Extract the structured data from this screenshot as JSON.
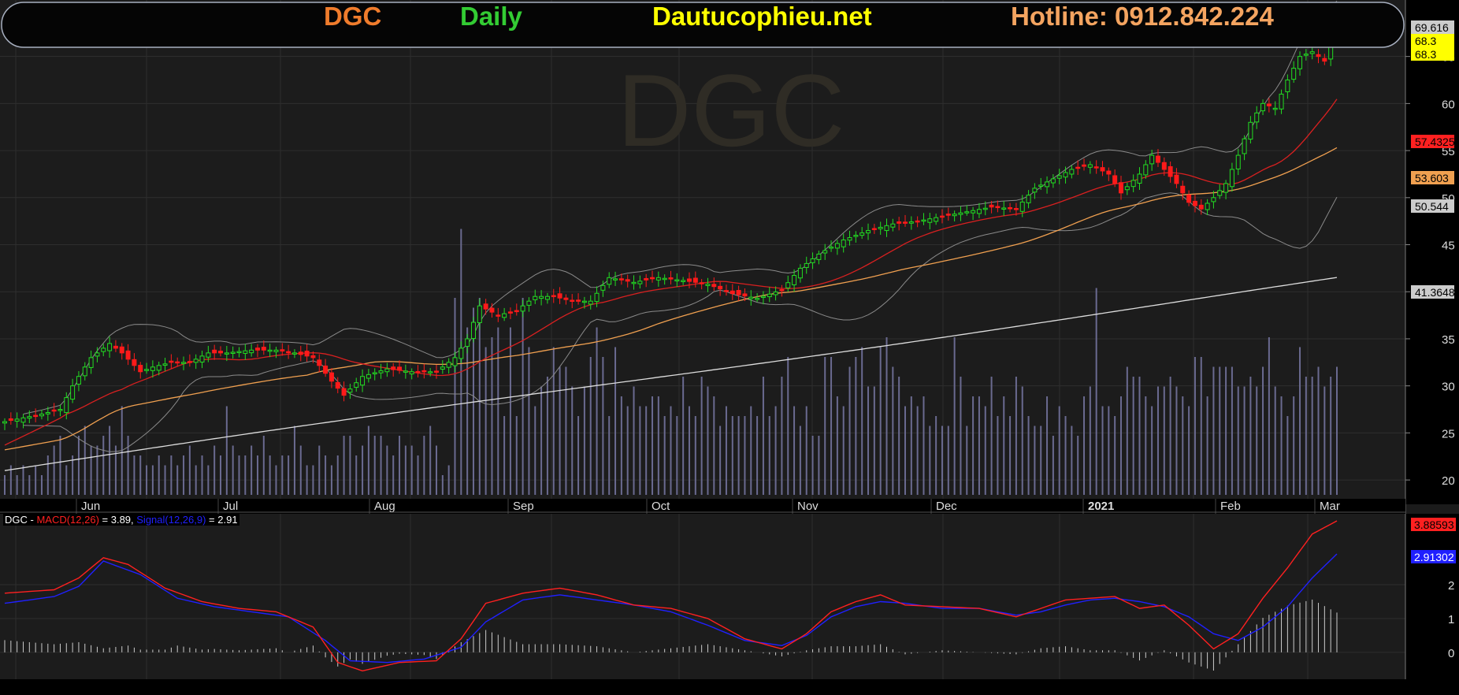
{
  "header": {
    "ticker": "DGC",
    "interval": "Daily",
    "site": "Dautucophieu.net",
    "hotline": "Hotline: 0912.842.224"
  },
  "colors": {
    "ticker": "#f07c2c",
    "interval": "#33cc33",
    "site": "#ffff00",
    "hotline": "#f4a460",
    "up_candle": "#22dd22",
    "down_candle": "#ff1a1a",
    "macd": "#ff2020",
    "signal": "#2020ff",
    "ma_short": "#d92020",
    "ma_mid": "#f0a050",
    "ma_long": "#dddddd",
    "bollinger": "#8a8a8a",
    "volume": "#6a6a90"
  },
  "watermark": "DGC",
  "chart_data": [
    {
      "type": "candlestick",
      "title": "DGC Daily",
      "x_labels": [
        "Jun",
        "Jul",
        "Aug",
        "Sep",
        "Oct",
        "Nov",
        "Dec",
        "2021",
        "Feb",
        "Mar"
      ],
      "y_ticks": [
        "20",
        "25",
        "30",
        "35",
        "40",
        "45",
        "50",
        "55",
        "60",
        "65"
      ],
      "ylim": [
        18,
        71
      ],
      "price_tags": [
        {
          "label": "69.616",
          "value": 69.616,
          "bg": "#cccccc",
          "fg": "#000000"
        },
        {
          "label": "68.3",
          "value": 68.3,
          "bg": "#ffff00",
          "fg": "#000000"
        },
        {
          "label": "68.3",
          "value": 68.3,
          "bg": "#ffff00",
          "fg": "#000000"
        },
        {
          "label": "57.4325",
          "value": 57.4325,
          "bg": "#ff2020",
          "fg": "#000000"
        },
        {
          "label": "53.603",
          "value": 53.603,
          "bg": "#f0a050",
          "fg": "#000000"
        },
        {
          "label": "50.544",
          "value": 50.544,
          "bg": "#cccccc",
          "fg": "#000000"
        },
        {
          "label": "41.3648",
          "value": 41.3648,
          "bg": "#cccccc",
          "fg": "#000000"
        }
      ],
      "close_anchors": [
        [
          0,
          26.2
        ],
        [
          6,
          27
        ],
        [
          9,
          27.5
        ],
        [
          11,
          30
        ],
        [
          14,
          33
        ],
        [
          17,
          34.5
        ],
        [
          19,
          33.5
        ],
        [
          22,
          31.5
        ],
        [
          24,
          32
        ],
        [
          27,
          32.5
        ],
        [
          30,
          32.5
        ],
        [
          33,
          33.5
        ],
        [
          36,
          33.5
        ],
        [
          40,
          33.8
        ],
        [
          44,
          33.8
        ],
        [
          47,
          33.5
        ],
        [
          50,
          33
        ],
        [
          53,
          30.5
        ],
        [
          55,
          29
        ],
        [
          58,
          31
        ],
        [
          62,
          31.8
        ],
        [
          66,
          31.5
        ],
        [
          70,
          31.5
        ],
        [
          73,
          33
        ],
        [
          75,
          35
        ],
        [
          77,
          38.5
        ],
        [
          80,
          37.5
        ],
        [
          83,
          38
        ],
        [
          86,
          39.5
        ],
        [
          89,
          39.5
        ],
        [
          92,
          39
        ],
        [
          95,
          39
        ],
        [
          98,
          41.5
        ],
        [
          102,
          41
        ],
        [
          106,
          41.5
        ],
        [
          110,
          41.2
        ],
        [
          114,
          40.8
        ],
        [
          118,
          39.8
        ],
        [
          122,
          39.3
        ],
        [
          126,
          40.2
        ],
        [
          129,
          42.5
        ],
        [
          132,
          44
        ],
        [
          136,
          45.5
        ],
        [
          140,
          46.5
        ],
        [
          144,
          47.2
        ],
        [
          148,
          47.5
        ],
        [
          152,
          48
        ],
        [
          156,
          48.5
        ],
        [
          160,
          49
        ],
        [
          164,
          48.8
        ],
        [
          167,
          51
        ],
        [
          170,
          52
        ],
        [
          173,
          53
        ],
        [
          176,
          53.5
        ],
        [
          179,
          52.5
        ],
        [
          181,
          50.5
        ],
        [
          184,
          52.5
        ],
        [
          186,
          54.5
        ],
        [
          188,
          53
        ],
        [
          190,
          51.5
        ],
        [
          192,
          49.5
        ],
        [
          194,
          48.8
        ],
        [
          196,
          50
        ],
        [
          198,
          51.5
        ],
        [
          200,
          54.5
        ],
        [
          202,
          58
        ],
        [
          204,
          60
        ],
        [
          206,
          59.5
        ],
        [
          208,
          62.5
        ],
        [
          210,
          65
        ],
        [
          212,
          65.5
        ],
        [
          214,
          64.5
        ],
        [
          216,
          68.3
        ]
      ],
      "volume_bars": [
        2,
        3,
        2,
        3,
        2,
        3,
        2,
        4,
        5,
        6,
        3,
        4,
        6,
        7,
        5,
        5,
        6,
        7,
        5,
        9,
        6,
        4,
        4,
        3,
        3,
        4,
        3,
        4,
        3,
        4,
        5,
        3,
        4,
        3,
        5,
        4,
        9,
        5,
        4,
        4,
        5,
        4,
        6,
        4,
        3,
        4,
        4,
        7,
        5,
        3,
        3,
        5,
        4,
        3,
        4,
        6,
        6,
        4,
        5,
        7,
        6,
        6,
        5,
        4,
        6,
        5,
        5,
        4,
        6,
        7,
        5,
        2,
        3,
        20,
        27,
        17,
        19,
        20,
        15,
        16,
        17,
        8,
        17,
        8,
        20,
        15,
        9,
        11,
        12,
        15,
        13,
        13,
        11,
        8,
        11,
        14,
        17,
        14,
        8,
        15,
        10,
        9,
        11,
        9,
        9,
        10,
        10,
        8,
        9,
        8,
        12,
        9,
        8,
        12,
        11,
        10,
        7,
        9,
        8,
        8,
        8,
        9,
        8,
        12,
        8,
        9,
        12,
        14,
        9,
        7,
        9,
        6,
        6,
        14,
        14,
        10,
        9,
        13,
        14,
        15,
        11,
        11,
        15,
        16,
        13,
        12,
        9,
        10,
        9,
        10,
        7,
        8,
        7,
        7,
        16,
        12,
        7,
        10,
        10,
        9,
        12,
        8,
        10,
        8,
        12,
        11,
        8,
        7,
        7,
        10,
        6,
        9,
        8,
        7,
        6,
        10,
        11,
        21,
        9,
        9,
        8,
        10,
        13,
        12,
        12,
        10,
        9,
        11,
        11,
        12,
        11,
        10,
        9,
        14,
        14,
        10,
        13,
        13,
        13,
        13,
        11,
        11,
        12,
        11,
        13,
        16,
        11,
        10,
        8,
        10,
        15,
        12,
        12,
        13,
        11,
        12,
        13,
        13,
        13,
        11,
        13,
        13,
        12,
        12,
        16,
        10,
        15,
        13,
        11,
        14,
        13,
        14,
        9,
        16,
        11,
        9,
        6,
        10,
        12,
        17,
        13,
        10,
        11,
        17,
        9,
        7,
        9,
        6,
        7,
        7,
        11,
        13,
        13,
        16,
        12,
        11,
        11,
        12,
        15,
        13,
        11,
        12,
        15,
        13,
        11,
        11,
        16,
        14,
        16,
        11,
        14,
        18,
        16,
        16,
        13,
        16
      ]
    },
    {
      "type": "line",
      "title": "DGC - MACD(12,26) = 3.89, Signal(12,26,9) = 2.91",
      "legend": {
        "prefix": "DGC - ",
        "macd_label": "MACD(12,26)",
        "macd_value": " = 3.89, ",
        "signal_label": "Signal(12,26,9)",
        "signal_value": " = 2.91"
      },
      "y_ticks": [
        "0",
        "1",
        "2"
      ],
      "ylim": [
        -0.75,
        4.1
      ],
      "price_tags": [
        {
          "label": "3.88593",
          "value": 3.88593,
          "bg": "#ff2020",
          "fg": "#000000"
        },
        {
          "label": "2.91302",
          "value": 2.91302,
          "bg": "#2020ff",
          "fg": "#ffffff"
        }
      ],
      "macd_anchors": [
        [
          0,
          1.75
        ],
        [
          8,
          1.85
        ],
        [
          12,
          2.2
        ],
        [
          16,
          2.8
        ],
        [
          20,
          2.6
        ],
        [
          26,
          1.9
        ],
        [
          32,
          1.5
        ],
        [
          38,
          1.3
        ],
        [
          44,
          1.2
        ],
        [
          50,
          0.75
        ],
        [
          54,
          -0.3
        ],
        [
          58,
          -0.55
        ],
        [
          64,
          -0.3
        ],
        [
          70,
          -0.25
        ],
        [
          74,
          0.4
        ],
        [
          78,
          1.45
        ],
        [
          84,
          1.75
        ],
        [
          90,
          1.9
        ],
        [
          96,
          1.7
        ],
        [
          102,
          1.4
        ],
        [
          108,
          1.3
        ],
        [
          114,
          1.0
        ],
        [
          120,
          0.4
        ],
        [
          126,
          0.1
        ],
        [
          130,
          0.55
        ],
        [
          134,
          1.2
        ],
        [
          138,
          1.5
        ],
        [
          142,
          1.7
        ],
        [
          146,
          1.4
        ],
        [
          152,
          1.35
        ],
        [
          158,
          1.3
        ],
        [
          164,
          1.05
        ],
        [
          168,
          1.3
        ],
        [
          172,
          1.55
        ],
        [
          176,
          1.6
        ],
        [
          180,
          1.65
        ],
        [
          184,
          1.3
        ],
        [
          188,
          1.4
        ],
        [
          192,
          0.8
        ],
        [
          196,
          0.1
        ],
        [
          200,
          0.55
        ],
        [
          204,
          1.6
        ],
        [
          208,
          2.5
        ],
        [
          212,
          3.5
        ],
        [
          216,
          3.89
        ]
      ],
      "signal_anchors": [
        [
          0,
          1.45
        ],
        [
          8,
          1.65
        ],
        [
          12,
          1.95
        ],
        [
          16,
          2.7
        ],
        [
          22,
          2.3
        ],
        [
          28,
          1.6
        ],
        [
          34,
          1.35
        ],
        [
          40,
          1.2
        ],
        [
          46,
          1.05
        ],
        [
          52,
          0.35
        ],
        [
          56,
          -0.25
        ],
        [
          62,
          -0.3
        ],
        [
          68,
          -0.2
        ],
        [
          74,
          0.15
        ],
        [
          78,
          0.9
        ],
        [
          84,
          1.55
        ],
        [
          90,
          1.7
        ],
        [
          96,
          1.55
        ],
        [
          102,
          1.4
        ],
        [
          108,
          1.2
        ],
        [
          114,
          0.8
        ],
        [
          120,
          0.35
        ],
        [
          126,
          0.2
        ],
        [
          130,
          0.5
        ],
        [
          134,
          1.05
        ],
        [
          138,
          1.35
        ],
        [
          142,
          1.5
        ],
        [
          146,
          1.45
        ],
        [
          152,
          1.3
        ],
        [
          158,
          1.3
        ],
        [
          164,
          1.1
        ],
        [
          168,
          1.2
        ],
        [
          172,
          1.4
        ],
        [
          176,
          1.55
        ],
        [
          180,
          1.6
        ],
        [
          184,
          1.5
        ],
        [
          188,
          1.35
        ],
        [
          192,
          1.05
        ],
        [
          196,
          0.55
        ],
        [
          200,
          0.35
        ],
        [
          204,
          0.75
        ],
        [
          208,
          1.35
        ],
        [
          212,
          2.2
        ],
        [
          216,
          2.91
        ]
      ]
    }
  ]
}
